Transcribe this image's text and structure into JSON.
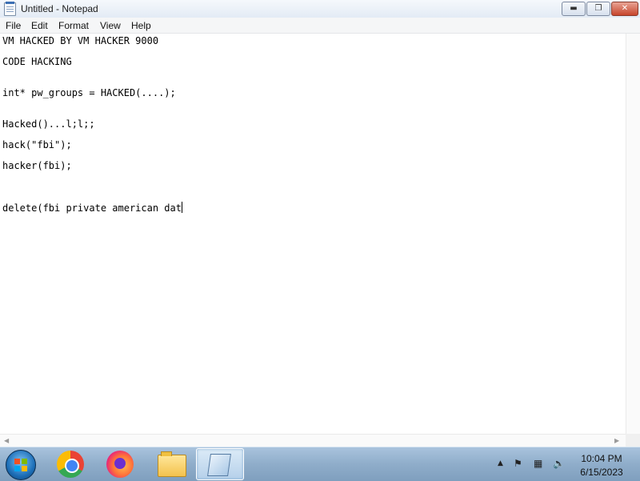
{
  "window": {
    "title": "Untitled - Notepad",
    "buttons": {
      "minimize": "▬",
      "maximize": "❐",
      "close": "✕"
    }
  },
  "menu": [
    "File",
    "Edit",
    "Format",
    "View",
    "Help"
  ],
  "editor": {
    "lines": [
      "VM HACKED BY VM HACKER 9000",
      "CODE HACKING",
      "int* pw_groups = HACKED(....);",
      "Hacked()...l;l;;",
      "hack(\"fbi\");",
      "hacker(fbi);",
      "delete(fbi private american dat"
    ]
  },
  "taskbar": {
    "icons": [
      "start-orb",
      "chrome-icon",
      "firefox-icon",
      "file-explorer-icon",
      "notepad-icon"
    ],
    "tray": {
      "time": "10:04 PM",
      "date": "6/15/2023",
      "icons": [
        "show-hidden-icons-arrow",
        "action-center-flag-icon",
        "network-icon",
        "volume-muted-icon"
      ]
    }
  }
}
